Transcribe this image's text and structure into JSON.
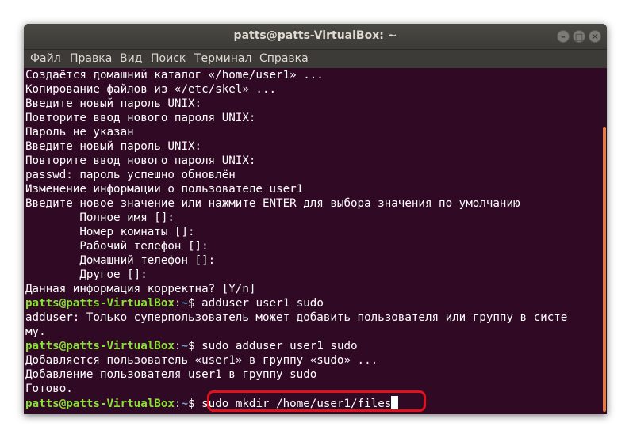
{
  "window": {
    "title": "patts@patts-VirtualBox: ~"
  },
  "window_buttons": {
    "minimize": "–",
    "maximize": "□",
    "close": "✕"
  },
  "menu": [
    "Файл",
    "Правка",
    "Вид",
    "Поиск",
    "Терминал",
    "Справка"
  ],
  "prompt": {
    "user": "patts@patts-VirtualBox",
    "path": "~",
    "symbol": "$ "
  },
  "terminal": {
    "lines": [
      "Создаётся домашний каталог «/home/user1» ...",
      "Копирование файлов из «/etc/skel» ...",
      "Введите новый пароль UNIX:",
      "Повторите ввод нового пароля UNIX:",
      "Пароль не указан",
      "Введите новый пароль UNIX:",
      "Повторите ввод нового пароля UNIX:",
      "passwd: пароль успешно обновлён",
      "Изменение информации о пользователе user1",
      "Введите новое значение или нажмите ENTER для выбора значения по умолчанию",
      "        Полное имя []:",
      "        Номер комнаты []:",
      "        Рабочий телефон []:",
      "        Домашний телефон []:",
      "        Другое []:",
      "Данная информация корректна? [Y/n]"
    ],
    "cmd1": "adduser user1 sudo",
    "out1a": "adduser: Только суперпользователь может добавить пользователя или группу в систе",
    "out1b": "му.",
    "cmd2": "sudo adduser user1 sudo",
    "out2a": "Добавляется пользователь «user1» в группу «sudo» ...",
    "out2b": "Добавление пользователя user1 в группу sudo",
    "out2c": "Готово.",
    "cmd3": "sudo mkdir /home/user1/files"
  },
  "colors": {
    "background": "#300a24",
    "prompt_user": "#8ae234",
    "prompt_path": "#729fcf",
    "highlight": "#e0111b",
    "scrollbar": "#e37b45"
  }
}
